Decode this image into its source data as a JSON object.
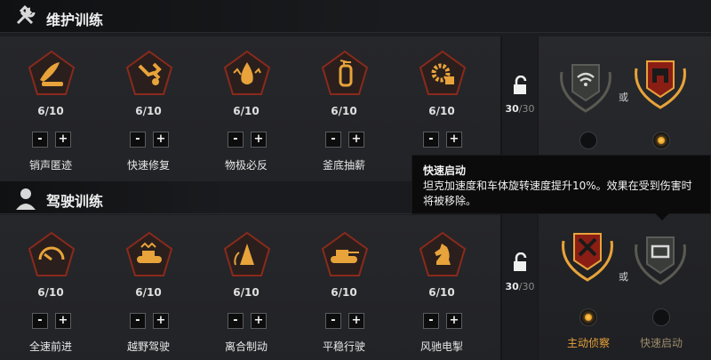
{
  "maintenance": {
    "title": "维护训练",
    "icon": "wrench-hammer-icon",
    "counter": {
      "current": "30",
      "max": "/30"
    },
    "skills": [
      {
        "level": "6/10",
        "name": "销声匿迹",
        "icon": "leaf-tank-icon"
      },
      {
        "level": "6/10",
        "name": "快速修复",
        "icon": "wrench-icon"
      },
      {
        "level": "6/10",
        "name": "物极必反",
        "icon": "fire-drop-icon"
      },
      {
        "level": "6/10",
        "name": "釜底抽薪",
        "icon": "fire-extinguisher-icon"
      },
      {
        "level": "6/10",
        "name": "",
        "icon": "gear-box-icon"
      }
    ],
    "perks": {
      "or": "或"
    }
  },
  "driving": {
    "title": "驾驶训练",
    "icon": "driver-icon",
    "counter": {
      "current": "30",
      "max": "/30"
    },
    "skills": [
      {
        "level": "6/10",
        "name": "全速前进",
        "icon": "speedometer-icon"
      },
      {
        "level": "6/10",
        "name": "越野驾驶",
        "icon": "tank-crown-icon"
      },
      {
        "level": "6/10",
        "name": "离合制动",
        "icon": "cone-icon"
      },
      {
        "level": "6/10",
        "name": "平稳行驶",
        "icon": "tank-icon"
      },
      {
        "level": "6/10",
        "name": "风驰电掣",
        "icon": "knight-icon"
      }
    ],
    "perks": {
      "or": "或",
      "left_label": "主动侦察",
      "right_label": "快速启动"
    }
  },
  "buttons": {
    "minus": "-",
    "plus": "+"
  },
  "tooltip": {
    "title": "快速启动",
    "body": "坦克加速度和车体旋转速度提升10%。效果在受到伤害时将被移除。"
  },
  "colors": {
    "accent": "#e8a33a",
    "badge_border": "#8a2a1c",
    "badge_fill": "#2a1f1c",
    "label_active": "#e8a33a",
    "label_inactive": "#9a8a6a"
  }
}
